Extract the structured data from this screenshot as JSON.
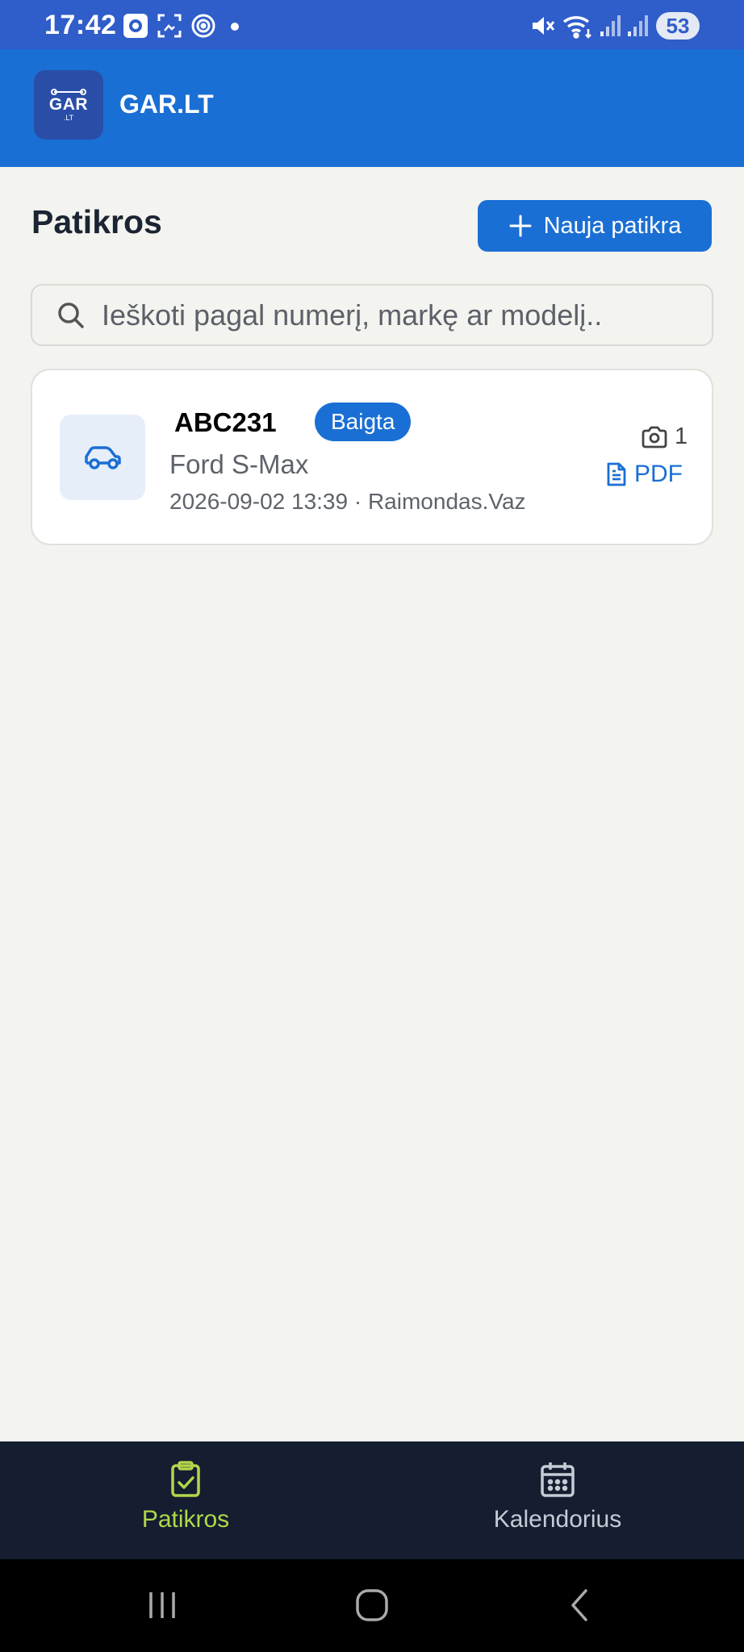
{
  "status_bar": {
    "time": "17:42",
    "battery": "53",
    "icons": [
      "camera-app-icon",
      "screenshot-icon",
      "nfc-icon",
      "dot-icon",
      "mute-icon",
      "wifi-icon",
      "signal-icon",
      "signal-icon",
      "battery-icon"
    ]
  },
  "app": {
    "logo_text": "GAR",
    "logo_sub": ".LT",
    "title": "GAR.LT",
    "colors": {
      "primary": "#1a6fd4",
      "status_bar": "#2f5dc9",
      "nav_bg": "#141e30",
      "nav_active": "#b3d64a",
      "page_bg": "#f3f4ef"
    }
  },
  "page": {
    "title": "Patikros",
    "new_button_label": "Nauja patikra"
  },
  "search": {
    "placeholder": "Ieškoti pagal numerį, markę ar modelį..",
    "value": ""
  },
  "inspections": [
    {
      "plate": "ABC231",
      "status": "Baigta",
      "model": "Ford S-Max",
      "meta": "2026-09-02 13:39 · Raimondas.Vaz",
      "photo_count": "1",
      "pdf_label": "PDF"
    }
  ],
  "bottom_nav": {
    "items": [
      {
        "label": "Patikros",
        "icon": "clipboard-check-icon",
        "active": true
      },
      {
        "label": "Kalendorius",
        "icon": "calendar-icon",
        "active": false
      }
    ]
  }
}
